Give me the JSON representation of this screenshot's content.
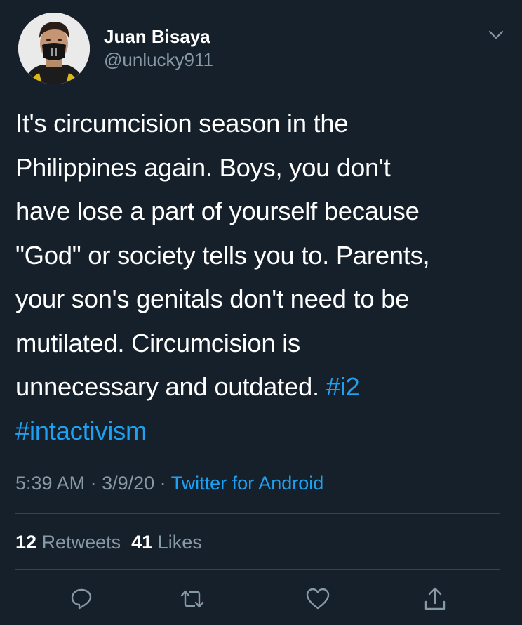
{
  "user": {
    "display_name": "Juan Bisaya",
    "handle": "@unlucky911"
  },
  "tweet": {
    "lines": [
      "It's circumcision season in the",
      "Philippines again. Boys, you don't",
      "have lose a part of yourself because",
      "\"God\" or society tells you to. Parents,",
      "your son's genitals don't need to be",
      "mutilated. Circumcision is",
      "unnecessary and outdated. "
    ],
    "hashtag_1": "#i2",
    "hashtag_2": "#intactivism"
  },
  "meta": {
    "time": "5:39 AM",
    "sep1": " · ",
    "date": "3/9/20",
    "sep2": " · ",
    "source": "Twitter for Android"
  },
  "stats": {
    "retweets_count": "12",
    "retweets_label": "Retweets",
    "likes_count": "41",
    "likes_label": "Likes"
  },
  "actions": {
    "reply_icon": "reply-icon",
    "retweet_icon": "retweet-icon",
    "like_icon": "heart-icon",
    "share_icon": "share-icon"
  },
  "colors": {
    "background": "#15202b",
    "text_primary": "#ffffff",
    "text_secondary": "#8899a6",
    "accent": "#1da1f2",
    "divider": "#38444d"
  }
}
